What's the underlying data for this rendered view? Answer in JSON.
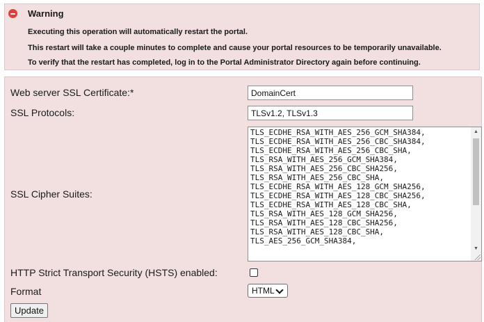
{
  "warning": {
    "title": "Warning",
    "lines": [
      "Executing this operation will automatically restart the portal.",
      "This restart will take a couple minutes to complete and cause your portal resources to be temporarily unavailable.",
      "To verify that the restart has completed, log in to the Portal Administrator Directory again before continuing."
    ]
  },
  "form": {
    "ssl_cert": {
      "label": "Web server SSL Certificate:*",
      "value": "DomainCert"
    },
    "ssl_protocols": {
      "label": "SSL Protocols:",
      "value": "TLSv1.2, TLSv1.3"
    },
    "cipher_suites": {
      "label": "SSL Cipher Suites:",
      "lines": [
        "TLS_ECDHE_RSA_WITH_AES_256_GCM_SHA384,",
        "TLS_ECDHE_RSA_WITH_AES_256_CBC_SHA384,",
        "TLS_ECDHE_RSA_WITH_AES_256_CBC_SHA,",
        "TLS_RSA_WITH_AES_256_GCM_SHA384,",
        "TLS_RSA_WITH_AES_256_CBC_SHA256,",
        "TLS_RSA_WITH_AES_256_CBC_SHA,",
        "TLS_ECDHE_RSA_WITH_AES_128_GCM_SHA256,",
        "TLS_ECDHE_RSA_WITH_AES_128_CBC_SHA256,",
        "TLS_ECDHE_RSA_WITH_AES_128_CBC_SHA,",
        "TLS_RSA_WITH_AES_128_GCM_SHA256,",
        "TLS_RSA_WITH_AES_128_CBC_SHA256,",
        "TLS_RSA_WITH_AES_128_CBC_SHA,",
        "TLS_AES_256_GCM_SHA384,"
      ]
    },
    "hsts": {
      "label": "HTTP Strict Transport Security (HSTS) enabled:",
      "checked": false
    },
    "format": {
      "label": "Format",
      "selected": "HTML"
    },
    "update_label": "Update"
  },
  "colors": {
    "panel_bg": "#f2e0e0",
    "warning_icon": "#e0403a"
  }
}
